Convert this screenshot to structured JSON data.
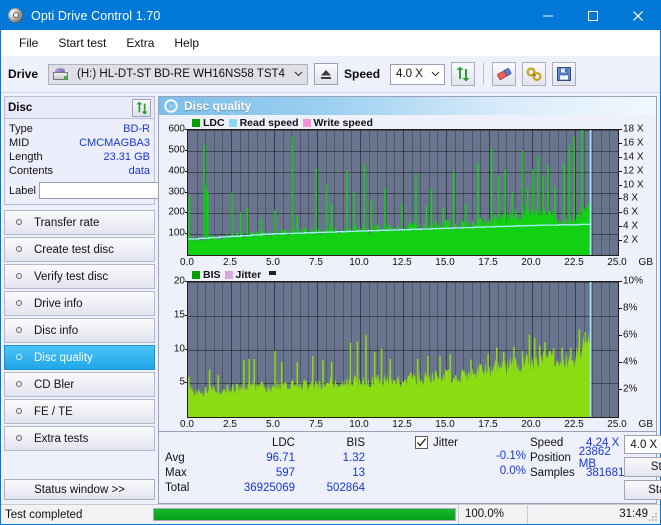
{
  "window": {
    "title": "Opti Drive Control 1.70",
    "app_icon": "disc-icon",
    "minimize": "─",
    "maximize": "□",
    "close": "✕"
  },
  "menu": [
    "File",
    "Start test",
    "Extra",
    "Help"
  ],
  "toolbar": {
    "drive_label": "Drive",
    "drive_value": "(H:)   HL-DT-ST BD-RE  WH16NS58 TST4",
    "eject_icon": "eject-icon",
    "speed_label": "Speed",
    "speed_value": "4.0 X",
    "refresh_icon": "refresh-icon",
    "eraser_icon": "eraser-icon",
    "tools_icon": "tools-icon",
    "save_icon": "save-icon"
  },
  "disc_panel": {
    "title": "Disc",
    "refresh_icon": "refresh-icon",
    "rows": [
      {
        "key": "Type",
        "value": "BD-R"
      },
      {
        "key": "MID",
        "value": "CMCMAGBA3"
      },
      {
        "key": "Length",
        "value": "23.31 GB"
      },
      {
        "key": "Contents",
        "value": "data"
      }
    ],
    "label_key": "Label",
    "label_value": "",
    "label_placeholder": "",
    "cd_icon": "cd-icon"
  },
  "nav": {
    "items": [
      {
        "label": "Transfer rate",
        "active": false
      },
      {
        "label": "Create test disc",
        "active": false
      },
      {
        "label": "Verify test disc",
        "active": false
      },
      {
        "label": "Drive info",
        "active": false
      },
      {
        "label": "Disc info",
        "active": false
      },
      {
        "label": "Disc quality",
        "active": true
      },
      {
        "label": "CD Bler",
        "active": false
      },
      {
        "label": "FE / TE",
        "active": false
      },
      {
        "label": "Extra tests",
        "active": false
      }
    ],
    "status_window_button": "Status window >>"
  },
  "panel": {
    "title": "Disc quality",
    "icon": "disc-quality-icon"
  },
  "chart_data": [
    {
      "type": "area",
      "name": "ldc-chart",
      "title": "",
      "xlabel": "GB",
      "ylabel": "",
      "ylim": [
        0,
        600
      ],
      "yticks": [
        100,
        200,
        300,
        400,
        500,
        600
      ],
      "y2lim": [
        0,
        18
      ],
      "y2ticks": [
        "2 X",
        "4 X",
        "6 X",
        "8 X",
        "10 X",
        "12 X",
        "14 X",
        "16 X",
        "18 X"
      ],
      "xlim": [
        0,
        25
      ],
      "xticks": [
        "0.0",
        "2.5",
        "5.0",
        "7.5",
        "10.0",
        "12.5",
        "15.0",
        "17.5",
        "20.0",
        "22.5",
        "25.0"
      ],
      "xunit": "GB",
      "grid": true,
      "legend": [
        {
          "label": "LDC",
          "color": "#00a000"
        },
        {
          "label": "Read speed",
          "color": "#8fd8f5"
        },
        {
          "label": "Write speed",
          "color": "#f48fd8"
        }
      ],
      "data_end_gb": 23.4,
      "series": [
        {
          "name": "LDC",
          "color": "#12d012",
          "baseline": [
            90,
            72,
            68,
            70,
            74,
            76,
            78,
            80,
            82,
            84,
            86,
            88,
            90,
            92,
            94,
            96,
            98,
            100,
            102,
            100,
            98,
            100,
            104,
            106,
            108,
            110,
            112,
            110,
            108,
            110,
            112,
            114,
            116,
            118,
            116,
            114,
            116,
            118,
            120,
            122,
            120,
            118,
            120,
            122,
            124,
            126,
            128,
            126,
            124,
            126,
            128,
            130,
            132,
            134,
            132,
            130,
            132,
            134,
            136,
            138,
            140,
            142,
            144,
            146,
            148,
            150,
            152,
            150,
            152,
            156,
            160,
            164,
            168,
            172,
            176,
            180,
            184,
            190,
            196,
            200,
            196,
            190,
            184,
            178,
            172,
            166,
            160,
            158,
            160,
            165,
            175,
            190,
            210,
            230
          ],
          "spikes": [
            {
              "x": 0.05,
              "y": 285
            },
            {
              "x": 0.95,
              "y": 530
            },
            {
              "x": 1.05,
              "y": 335
            },
            {
              "x": 1.15,
              "y": 300
            },
            {
              "x": 2.55,
              "y": 300
            },
            {
              "x": 3.05,
              "y": 205
            },
            {
              "x": 3.45,
              "y": 230
            },
            {
              "x": 4.25,
              "y": 175
            },
            {
              "x": 5.05,
              "y": 215
            },
            {
              "x": 6.05,
              "y": 568
            },
            {
              "x": 6.35,
              "y": 190
            },
            {
              "x": 7.45,
              "y": 415
            },
            {
              "x": 8.05,
              "y": 340
            },
            {
              "x": 8.35,
              "y": 245
            },
            {
              "x": 9.25,
              "y": 405
            },
            {
              "x": 9.65,
              "y": 300
            },
            {
              "x": 10.25,
              "y": 438
            },
            {
              "x": 10.65,
              "y": 260
            },
            {
              "x": 11.45,
              "y": 326
            },
            {
              "x": 12.45,
              "y": 250
            },
            {
              "x": 13.25,
              "y": 390
            },
            {
              "x": 13.85,
              "y": 237
            },
            {
              "x": 14.15,
              "y": 320
            },
            {
              "x": 14.85,
              "y": 230
            },
            {
              "x": 15.45,
              "y": 402
            },
            {
              "x": 16.15,
              "y": 245
            },
            {
              "x": 16.85,
              "y": 443
            },
            {
              "x": 17.65,
              "y": 515
            },
            {
              "x": 18.05,
              "y": 383
            },
            {
              "x": 18.45,
              "y": 410
            },
            {
              "x": 18.85,
              "y": 300
            },
            {
              "x": 19.45,
              "y": 503
            },
            {
              "x": 19.75,
              "y": 330
            },
            {
              "x": 20.05,
              "y": 412
            },
            {
              "x": 20.35,
              "y": 479
            },
            {
              "x": 20.65,
              "y": 378
            },
            {
              "x": 20.95,
              "y": 433
            },
            {
              "x": 21.35,
              "y": 330
            },
            {
              "x": 21.85,
              "y": 443
            },
            {
              "x": 22.15,
              "y": 527
            },
            {
              "x": 22.45,
              "y": 570
            },
            {
              "x": 22.9,
              "y": 600
            }
          ]
        },
        {
          "name": "Read speed",
          "color": "#a8f0ff",
          "steps": [
            2.3,
            2.4,
            2.5,
            2.6,
            2.7,
            2.8,
            2.9,
            3.0,
            3.05,
            3.1,
            3.15,
            3.2,
            3.25,
            3.3,
            3.35,
            3.4,
            3.45,
            3.5,
            3.55,
            3.6,
            3.65,
            3.7,
            3.75,
            3.8,
            3.85,
            3.9,
            3.95,
            4.0,
            4.05,
            4.1,
            4.15,
            4.2,
            4.25,
            4.3,
            4.3,
            4.35,
            4.35,
            4.4
          ]
        }
      ]
    },
    {
      "type": "area",
      "name": "bis-chart",
      "title": "",
      "xlabel": "GB",
      "ylim": [
        0,
        20
      ],
      "yticks": [
        5,
        10,
        15,
        20
      ],
      "y2lim": [
        0,
        10
      ],
      "y2ticks": [
        "2%",
        "4%",
        "6%",
        "8%",
        "10%"
      ],
      "xlim": [
        0,
        25
      ],
      "xticks": [
        "0.0",
        "2.5",
        "5.0",
        "7.5",
        "10.0",
        "12.5",
        "15.0",
        "17.5",
        "20.0",
        "22.5",
        "25.0"
      ],
      "xunit": "GB",
      "grid": true,
      "legend": [
        {
          "label": "BIS",
          "color": "#00a000"
        },
        {
          "label": "Jitter",
          "color": "#d8a8e0"
        }
      ],
      "data_end_gb": 23.4,
      "series": [
        {
          "name": "BIS",
          "color": "#8cdc14",
          "baseline": [
            4.5,
            3.6,
            3.4,
            3.5,
            3.6,
            3.7,
            3.8,
            3.7,
            3.8,
            3.9,
            4.0,
            4.1,
            4.2,
            4.1,
            4.2,
            4.3,
            4.2,
            4.3,
            4.4,
            4.3,
            4.4,
            4.5,
            4.4,
            4.5,
            4.6,
            4.5,
            4.6,
            4.7,
            4.6,
            4.7,
            4.8,
            4.7,
            4.8,
            4.9,
            4.8,
            4.9,
            5.0,
            4.9,
            5.0,
            5.1,
            5.0,
            5.1,
            5.2,
            5.1,
            5.2,
            5.3,
            5.2,
            5.3,
            5.4,
            5.3,
            5.4,
            5.5,
            5.4,
            5.5,
            5.6,
            5.5,
            5.6,
            5.7,
            5.6,
            5.7,
            5.8,
            5.9,
            6.0,
            6.1,
            6.2,
            6.3,
            6.4,
            6.5,
            6.6,
            6.7,
            6.8,
            6.9,
            7.0,
            7.1,
            7.2,
            7.3,
            7.4,
            7.5,
            7.6,
            7.7,
            7.8,
            7.9,
            8.0,
            8.1,
            8.2,
            8.1,
            8.0,
            8.1,
            8.3,
            8.5,
            8.8,
            9.2,
            9.6,
            10.2,
            10.8
          ],
          "peaks": [
            {
              "x": 0.05,
              "y": 6.0
            },
            {
              "x": 1.25,
              "y": 7.0
            },
            {
              "x": 1.75,
              "y": 6.2
            },
            {
              "x": 3.25,
              "y": 8.4
            },
            {
              "x": 3.55,
              "y": 8.6
            },
            {
              "x": 3.85,
              "y": 8.6
            },
            {
              "x": 5.05,
              "y": 9.8
            },
            {
              "x": 5.45,
              "y": 8.2
            },
            {
              "x": 6.35,
              "y": 8.1
            },
            {
              "x": 7.25,
              "y": 9.0
            },
            {
              "x": 7.85,
              "y": 8.4
            },
            {
              "x": 8.35,
              "y": 8.2
            },
            {
              "x": 9.45,
              "y": 11.0
            },
            {
              "x": 9.85,
              "y": 11.2
            },
            {
              "x": 10.35,
              "y": 12.2
            },
            {
              "x": 10.85,
              "y": 9.6
            },
            {
              "x": 11.25,
              "y": 10.1
            },
            {
              "x": 11.75,
              "y": 8.6
            },
            {
              "x": 13.35,
              "y": 8.6
            },
            {
              "x": 13.95,
              "y": 9.1
            },
            {
              "x": 14.65,
              "y": 9.0
            },
            {
              "x": 15.25,
              "y": 9.3
            },
            {
              "x": 16.45,
              "y": 8.5
            },
            {
              "x": 17.45,
              "y": 9.4
            },
            {
              "x": 17.95,
              "y": 10.3
            },
            {
              "x": 18.35,
              "y": 9.6
            },
            {
              "x": 18.95,
              "y": 10.4
            },
            {
              "x": 19.45,
              "y": 9.8
            },
            {
              "x": 19.85,
              "y": 12.2
            },
            {
              "x": 20.15,
              "y": 11.7
            },
            {
              "x": 20.45,
              "y": 10.6
            },
            {
              "x": 20.75,
              "y": 11.1
            },
            {
              "x": 21.25,
              "y": 10.2
            },
            {
              "x": 21.75,
              "y": 10.3
            },
            {
              "x": 22.25,
              "y": 10.2
            },
            {
              "x": 22.75,
              "y": 13.0
            },
            {
              "x": 23.1,
              "y": 12.6
            }
          ]
        }
      ]
    }
  ],
  "stats": {
    "col_ldc": "LDC",
    "col_bis": "BIS",
    "rows": [
      {
        "label": "Avg",
        "ldc": "96.71",
        "bis": "1.32"
      },
      {
        "label": "Max",
        "ldc": "597",
        "bis": "13"
      },
      {
        "label": "Total",
        "ldc": "36925069",
        "bis": "502864"
      }
    ],
    "jitter_label": "Jitter",
    "jitter_checked": true,
    "jitter_avg": "-0.1%",
    "jitter_max": "0.0%",
    "speed_label": "Speed",
    "speed_value": "4.24 X",
    "position_label": "Position",
    "position_value": "23862 MB",
    "samples_label": "Samples",
    "samples_value": "381681",
    "speed_select": "4.0 X",
    "start_full": "Start full",
    "start_part": "Start part"
  },
  "statusbar": {
    "message": "Test completed",
    "percent": "100.0%",
    "progress": 100,
    "time": "31:49"
  },
  "colors": {
    "accent": "#0078d7",
    "plot_bg": "#69748f",
    "ldc_green": "#12d012",
    "bis_green": "#8cdc14",
    "read_speed": "#a8f0ff",
    "value_blue": "#1638d6",
    "progress_green": "#0fb024"
  }
}
